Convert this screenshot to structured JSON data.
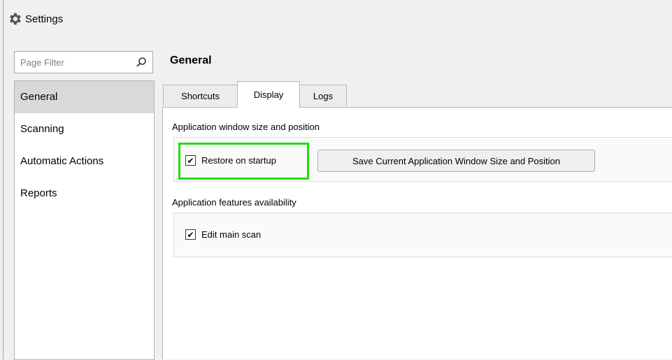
{
  "window": {
    "title": "Settings",
    "icon": "gear-icon"
  },
  "filter": {
    "placeholder": "Page Filter",
    "value": "",
    "icon": "search-icon"
  },
  "sidebar": {
    "items": [
      {
        "label": "General",
        "selected": true
      },
      {
        "label": "Scanning",
        "selected": false
      },
      {
        "label": "Automatic Actions",
        "selected": false
      },
      {
        "label": "Reports",
        "selected": false
      }
    ]
  },
  "page": {
    "title": "General"
  },
  "tabs": [
    {
      "label": "Shortcuts",
      "active": false
    },
    {
      "label": "Display",
      "active": true
    },
    {
      "label": "Logs",
      "active": false
    }
  ],
  "groups": {
    "window": {
      "label": "Application window size and position",
      "restore_label": "Restore on startup",
      "restore_checked": true,
      "save_button_label": "Save Current Application Window Size and Position"
    },
    "features": {
      "label": "Application features availability",
      "edit_main_scan_label": "Edit main scan",
      "edit_main_scan_checked": true
    }
  },
  "checkmark": "✔",
  "highlight_color": "#22dd11"
}
